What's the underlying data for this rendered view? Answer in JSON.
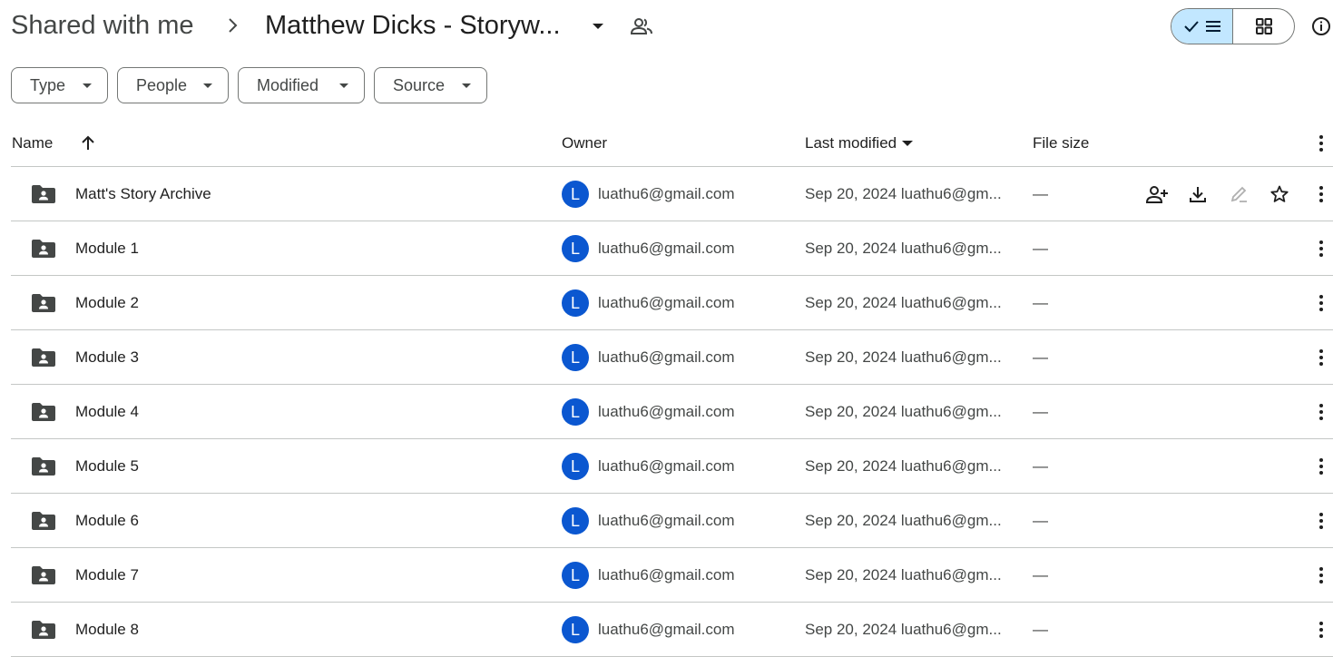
{
  "breadcrumb": {
    "root": "Shared with me",
    "current": "Matthew Dicks - Storyw..."
  },
  "filters": [
    {
      "label": "Type"
    },
    {
      "label": "People"
    },
    {
      "label": "Modified"
    },
    {
      "label": "Source"
    }
  ],
  "columns": {
    "name": "Name",
    "owner": "Owner",
    "modified": "Last modified",
    "size": "File size"
  },
  "rows": [
    {
      "name": "Matt's Story Archive",
      "avatar": "L",
      "owner": "luathu6@gmail.com",
      "modified": "Sep 20, 2024  luathu6@gm...",
      "size": "—"
    },
    {
      "name": "Module 1",
      "avatar": "L",
      "owner": "luathu6@gmail.com",
      "modified": "Sep 20, 2024  luathu6@gm...",
      "size": "—"
    },
    {
      "name": "Module 2",
      "avatar": "L",
      "owner": "luathu6@gmail.com",
      "modified": "Sep 20, 2024  luathu6@gm...",
      "size": "—"
    },
    {
      "name": "Module 3",
      "avatar": "L",
      "owner": "luathu6@gmail.com",
      "modified": "Sep 20, 2024  luathu6@gm...",
      "size": "—"
    },
    {
      "name": "Module 4",
      "avatar": "L",
      "owner": "luathu6@gmail.com",
      "modified": "Sep 20, 2024  luathu6@gm...",
      "size": "—"
    },
    {
      "name": "Module 5",
      "avatar": "L",
      "owner": "luathu6@gmail.com",
      "modified": "Sep 20, 2024  luathu6@gm...",
      "size": "—"
    },
    {
      "name": "Module 6",
      "avatar": "L",
      "owner": "luathu6@gmail.com",
      "modified": "Sep 20, 2024  luathu6@gm...",
      "size": "—"
    },
    {
      "name": "Module 7",
      "avatar": "L",
      "owner": "luathu6@gmail.com",
      "modified": "Sep 20, 2024  luathu6@gm...",
      "size": "—"
    },
    {
      "name": "Module 8",
      "avatar": "L",
      "owner": "luathu6@gmail.com",
      "modified": "Sep 20, 2024  luathu6@gm...",
      "size": "—"
    }
  ],
  "colors": {
    "avatar": "#0b57d0",
    "toggle_active": "#c2e7ff",
    "divider": "#c4c7c5"
  },
  "icons": {
    "folder": "shared-folder-icon",
    "share": "add-person-icon",
    "download": "download-icon",
    "rename": "pencil-icon",
    "star": "star-icon",
    "more": "more-vert-icon"
  }
}
